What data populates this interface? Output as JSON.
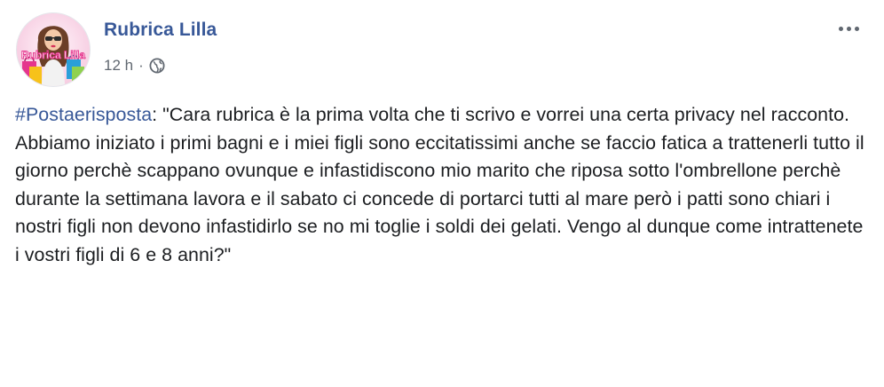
{
  "post": {
    "author": "Rubrica Lilla",
    "avatar": {
      "label": "Rubrica Lilla"
    },
    "timestamp": "12 h",
    "separator": "·",
    "audience_icon": "globe-icon",
    "more_icon": "ellipsis-icon",
    "hashtag": "#Postaerisposta",
    "after_hashtag": ": \"Cara rubrica è la prima volta che ti scrivo e vorrei una certa privacy nel racconto.",
    "paragraph_2": "Abbiamo iniziato i primi bagni e i miei figli sono eccitatissimi anche se faccio fatica a trattenerli tutto il giorno perchè scappano ovunque e infastidiscono mio marito che riposa sotto l'ombrellone perchè durante la settimana lavora e il sabato ci concede di portarci tutti al mare però i patti sono chiari i nostri figli non devono infastidirlo se no mi toglie i soldi dei gelati. Vengo al dunque come intrattenete i vostri figli di 6 e 8 anni?\""
  },
  "colors": {
    "link": "#385898",
    "text": "#1c1e21",
    "meta": "#606770"
  }
}
